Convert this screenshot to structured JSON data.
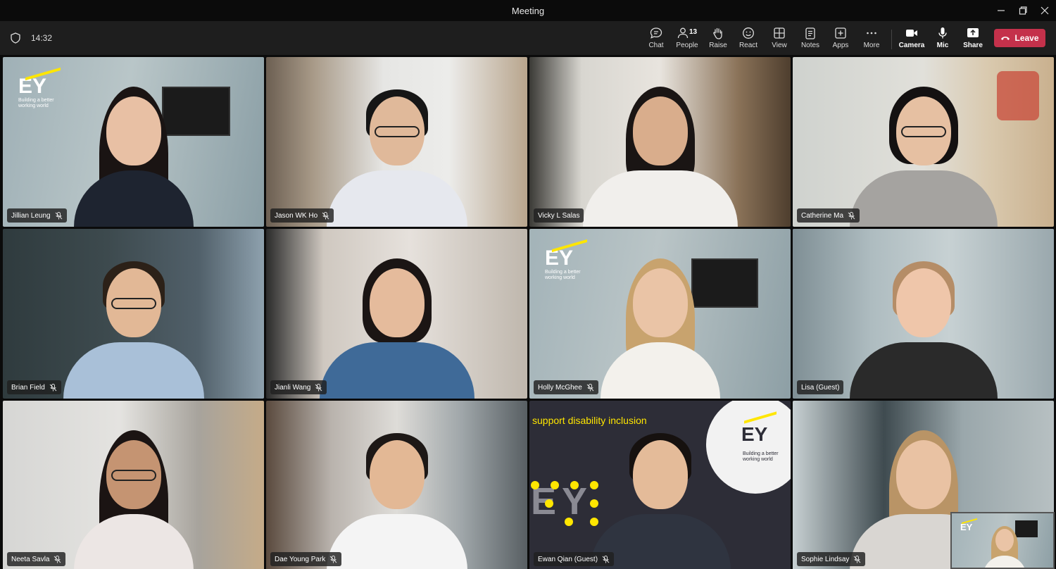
{
  "window": {
    "title": "Meeting"
  },
  "toolbar": {
    "timer": "14:32",
    "buttons": [
      {
        "id": "chat",
        "label": "Chat",
        "icon": "chat-icon"
      },
      {
        "id": "people",
        "label": "People",
        "icon": "people-icon",
        "count": "13"
      },
      {
        "id": "raise",
        "label": "Raise",
        "icon": "hand-icon"
      },
      {
        "id": "react",
        "label": "React",
        "icon": "smile-icon"
      },
      {
        "id": "view",
        "label": "View",
        "icon": "grid-icon"
      },
      {
        "id": "notes",
        "label": "Notes",
        "icon": "notes-icon"
      },
      {
        "id": "apps",
        "label": "Apps",
        "icon": "plus-square-icon"
      },
      {
        "id": "more",
        "label": "More",
        "icon": "ellipsis-icon"
      },
      {
        "id": "camera",
        "label": "Camera",
        "icon": "camera-icon"
      },
      {
        "id": "mic",
        "label": "Mic",
        "icon": "mic-icon"
      },
      {
        "id": "share",
        "label": "Share",
        "icon": "share-icon"
      }
    ],
    "leave_label": "Leave",
    "leave_color": "#c4314b"
  },
  "participants": [
    {
      "name": "Jillian Leung",
      "muted": true
    },
    {
      "name": "Jason WK Ho",
      "muted": true
    },
    {
      "name": "Vicky L Salas",
      "muted": false
    },
    {
      "name": "Catherine Ma",
      "muted": true
    },
    {
      "name": "Brian Field",
      "muted": true
    },
    {
      "name": "Jianli Wang",
      "muted": true
    },
    {
      "name": "Holly McGhee",
      "muted": true
    },
    {
      "name": "Lisa (Guest)",
      "muted": false,
      "active_speaker": true
    },
    {
      "name": "Neeta Savla",
      "muted": true
    },
    {
      "name": "Dae Young Park",
      "muted": true
    },
    {
      "name": "Ewan Qian (Guest)",
      "muted": true
    },
    {
      "name": "Sophie Lindsay",
      "muted": true
    }
  ],
  "backgrounds": {
    "ey_logo": "EY",
    "ey_tagline": "Building a better working world",
    "slogan": "support disability inclusion",
    "big_letters": "EY"
  },
  "colors": {
    "accent": "#8a88e6",
    "ey_yellow": "#ffe600"
  }
}
